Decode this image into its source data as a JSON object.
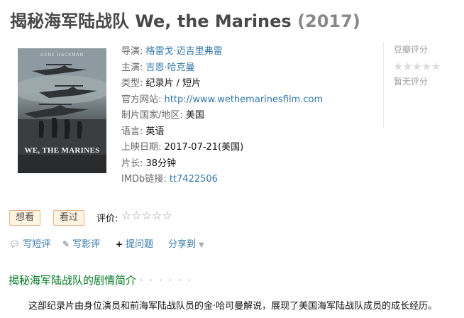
{
  "title": {
    "main": "揭秘海军陆战队 We, the Marines",
    "year": "(2017)"
  },
  "poster": {
    "top_text": "GENE HACKMAN",
    "title_text": "WE, THE MARINES"
  },
  "info": {
    "director_label": "导演",
    "director": "格雷戈·迈吉里弗雷",
    "cast_label": "主演",
    "cast": "吉恩·哈克曼",
    "genre_label": "类型:",
    "genre": "纪录片 / 短片",
    "website_label": "官方网站:",
    "website": "http://www.wethemarinesfilm.com",
    "country_label": "制片国家/地区:",
    "country": "美国",
    "language_label": "语言:",
    "language": "英语",
    "release_label": "上映日期:",
    "release": "2017-07-21(美国)",
    "runtime_label": "片长:",
    "runtime": "38分钟",
    "imdb_label": "IMDb链接:",
    "imdb": "tt7422506"
  },
  "rating": {
    "label": "豆瓣评分",
    "stars": "★★★★★",
    "no_rating": "暂无评分"
  },
  "actions": {
    "want": "想看",
    "watched": "看过",
    "rate_label": "评价:",
    "rate_stars": "☆☆☆☆☆",
    "write_short": "写短评",
    "write_review": "写影评",
    "ask": "提问题",
    "share": "分享到"
  },
  "synopsis": {
    "heading": "揭秘海军陆战队的剧情简介",
    "dots": "· · · · · ·",
    "text": "这部纪录片由身位演员和前海军陆战队员的金·哈可曼解说，展现了美国海军陆战队成员的成长经历。"
  }
}
